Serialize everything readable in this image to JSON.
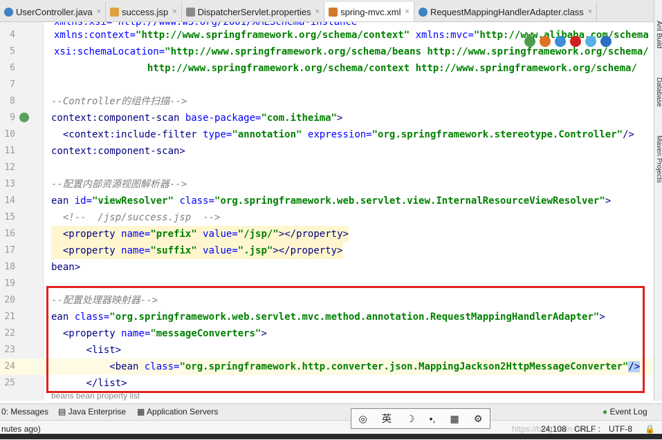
{
  "tabs": [
    {
      "label": "UserController.java",
      "icon": "java-class-icon",
      "active": false
    },
    {
      "label": "success.jsp",
      "icon": "jsp-file-icon",
      "active": false
    },
    {
      "label": "DispatcherServlet.properties",
      "icon": "properties-file-icon",
      "active": false
    },
    {
      "label": "spring-mvc.xml",
      "icon": "xml-file-icon",
      "active": true
    },
    {
      "label": "RequestMappingHandlerAdapter.class",
      "icon": "java-class-icon",
      "active": false
    }
  ],
  "tab_close_glyph": "×",
  "side_tools": [
    "Ant Build",
    "Database",
    "Maven Projects"
  ],
  "line_numbers": [
    "4",
    "5",
    "6",
    "7",
    "8",
    "9",
    "10",
    "11",
    "12",
    "13",
    "14",
    "15",
    "16",
    "17",
    "18",
    "19",
    "20",
    "21",
    "22",
    "23",
    "24",
    "25"
  ],
  "top_partial_line": "xmlns:xsi=\"http://www.w3.org/2001/XMLSchema-instance\"",
  "code": {
    "l4": {
      "a1": "xmlns:context=",
      "v1": "\"http://www.springframework.org/schema/context\"",
      "a2": " xmlns:mvc=",
      "v2": "\"http://www.alibaba.com/schema"
    },
    "l5": {
      "a1": "xsi:schemaLocation=",
      "v1": "\"http://www.springframework.org/schema/beans http://www.springframework.org/schema/"
    },
    "l6": {
      "v1": "                http://www.springframework.org/schema/context http://www.springframework.org/schema/"
    },
    "l8": "--Controller的组件扫描-->",
    "l9": {
      "t": "context:component-scan ",
      "a": "base-package=",
      "v": "\"com.itheima\"",
      "e": ">"
    },
    "l10": {
      "t": "  <context:include-filter ",
      "a1": "type=",
      "v1": "\"annotation\"",
      "a2": " expression=",
      "v2": "\"org.springframework.stereotype.Controller\"",
      "e": "/>"
    },
    "l11": "context:component-scan>",
    "l13": "--配置内部资源视图解析器-->",
    "l14": {
      "t": "ean ",
      "a1": "id=",
      "v1": "\"viewResolver\"",
      "a2": " class=",
      "v2": "\"org.springframework.web.servlet.view.InternalResourceViewResolver\"",
      "e": ">"
    },
    "l15": "  <!--  /jsp/success.jsp  -->",
    "l16": {
      "t": "  <property ",
      "a1": "name=",
      "v1": "\"prefix\"",
      "a2": " value=",
      "v2": "\"/jsp/\"",
      "e": "></property>"
    },
    "l17": {
      "t": "  <property ",
      "a1": "name=",
      "v1": "\"suffix\"",
      "a2": " value=",
      "v2": "\".jsp\"",
      "e": "></property>"
    },
    "l18": "bean>",
    "l20": "--配置处理器映射器-->",
    "l21": {
      "t": "ean ",
      "a1": "class=",
      "v1": "\"org.springframework.web.servlet.mvc.method.annotation.RequestMappingHandlerAdapter\"",
      "e": ">"
    },
    "l22": {
      "t": "  <property ",
      "a1": "name=",
      "v1": "\"messageConverters\"",
      "e": ">"
    },
    "l23": "      <list>",
    "l24": {
      "t": "          <bean ",
      "a1": "class=",
      "v1": "\"org.springframework.http.converter.json.MappingJackson2HttpMessageConverter\"",
      "e": "/>"
    },
    "l25": "      </list>"
  },
  "breadcrumb": "beans  bean  property  list",
  "status": {
    "messages": "0: Messages",
    "java_enterprise": "Java Enterprise",
    "app_servers": "Application Servers",
    "event_log": "Event Log",
    "minutes_ago": "nutes ago)",
    "position": "24:108",
    "line_sep": "CRLF :",
    "encoding": "UTF-8",
    "watermark": "https://blog.csdn.net/..."
  },
  "ime": {
    "label": "英"
  },
  "colors": {
    "highlight_box": "#e02020",
    "current_line": "#fffae3"
  }
}
